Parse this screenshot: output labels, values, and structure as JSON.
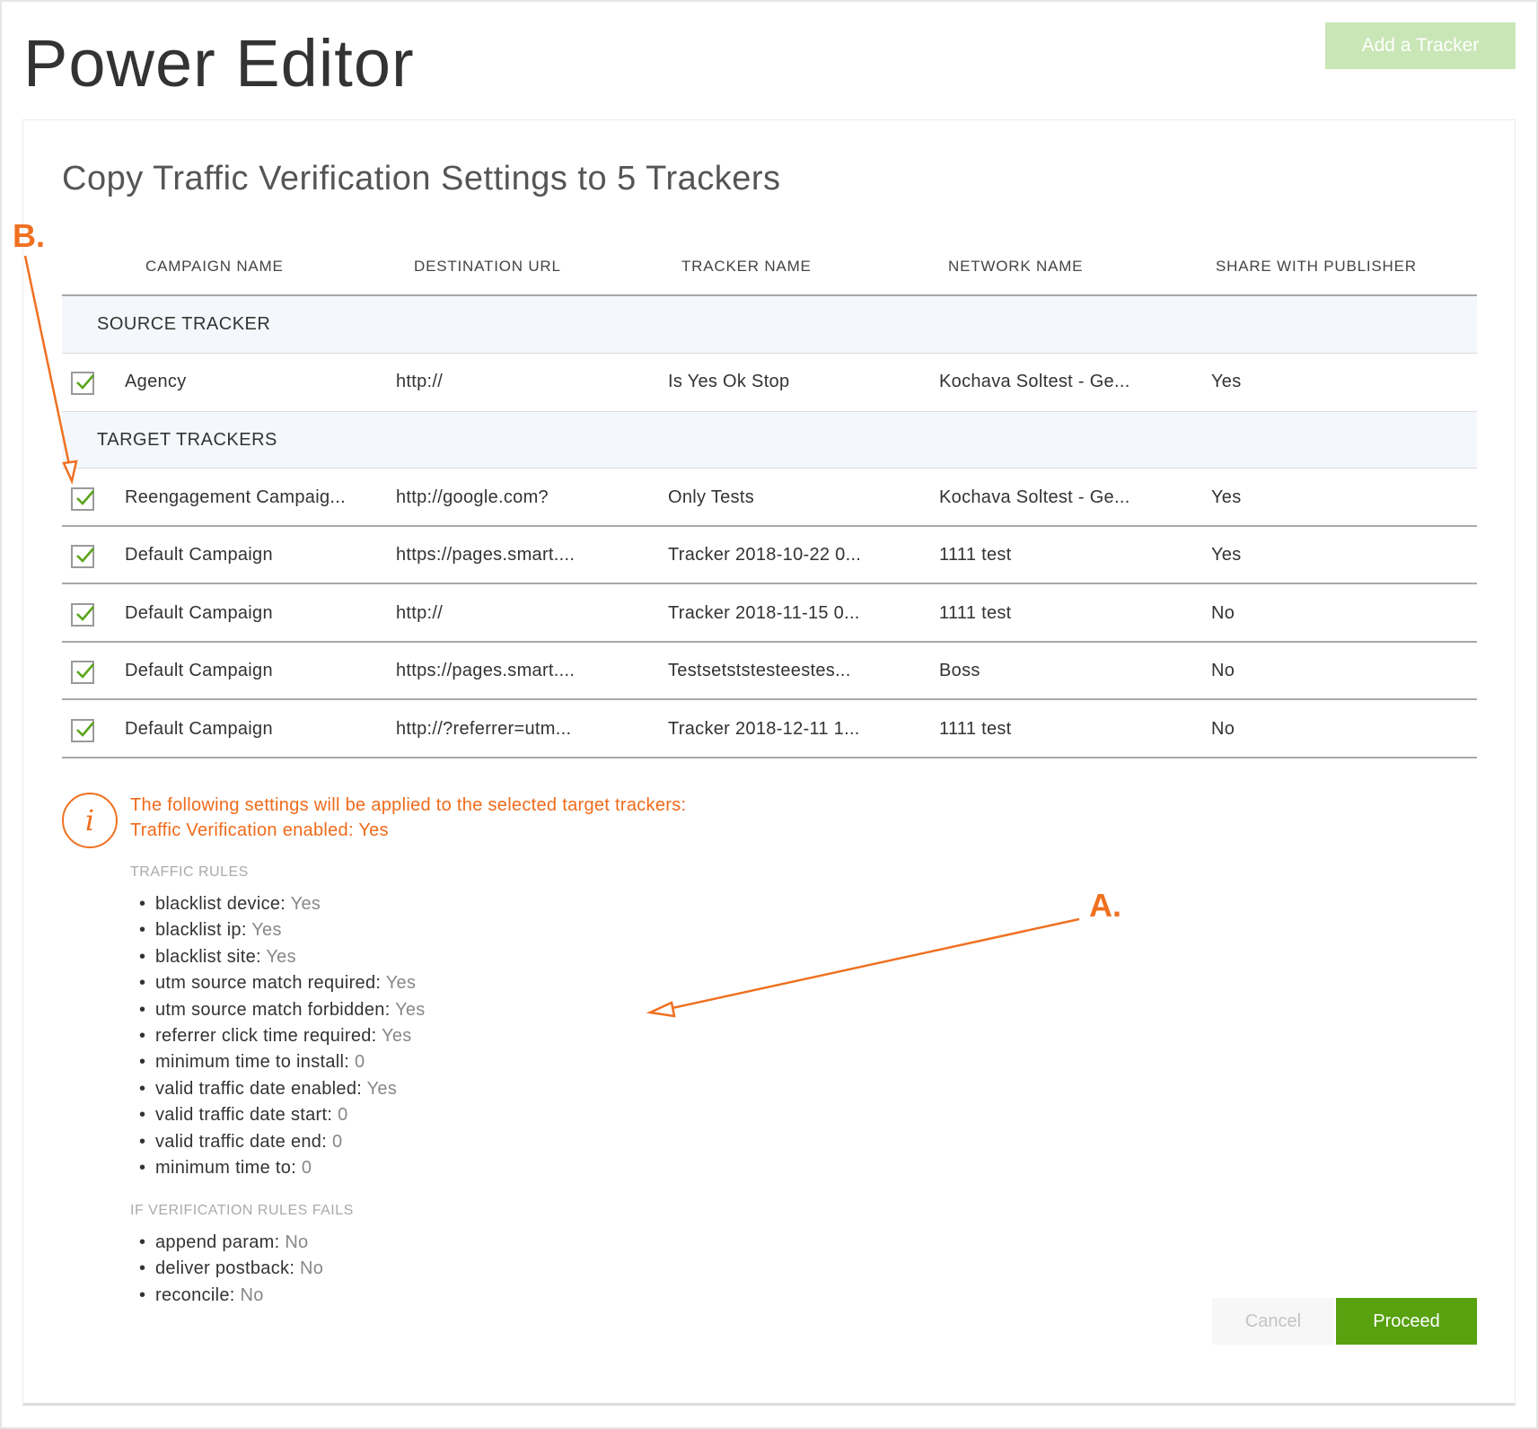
{
  "header": {
    "title": "Power Editor",
    "add_tracker_label": "Add a Tracker"
  },
  "dialog": {
    "title": "Copy Traffic Verification Settings to 5 Trackers",
    "columns": [
      "CAMPAIGN NAME",
      "DESTINATION URL",
      "TRACKER NAME",
      "NETWORK NAME",
      "SHARE WITH PUBLISHER"
    ],
    "source_section_label": "SOURCE TRACKER",
    "source_row": {
      "checked": true,
      "campaign": "Agency",
      "url": "http://",
      "tracker": "Is Yes Ok Stop",
      "network": "Kochava Soltest - Ge...",
      "share": "Yes"
    },
    "target_section_label": "TARGET TRACKERS",
    "target_rows": [
      {
        "checked": true,
        "campaign": "Reengagement Campaig...",
        "url": "http://google.com?",
        "tracker": "Only Tests",
        "network": "Kochava Soltest - Ge...",
        "share": "Yes"
      },
      {
        "checked": true,
        "campaign": "Default Campaign",
        "url": "https://pages.smart....",
        "tracker": "Tracker 2018-10-22 0...",
        "network": "1111 test",
        "share": "Yes"
      },
      {
        "checked": true,
        "campaign": "Default Campaign",
        "url": "http://",
        "tracker": "Tracker 2018-11-15 0...",
        "network": "1111 test",
        "share": "No"
      },
      {
        "checked": true,
        "campaign": "Default Campaign",
        "url": "https://pages.smart....",
        "tracker": "Testsetststesteestes...",
        "network": "Boss",
        "share": "No"
      },
      {
        "checked": true,
        "campaign": "Default Campaign",
        "url": "http://?referrer=utm...",
        "tracker": "Tracker 2018-12-11 1...",
        "network": "1111 test",
        "share": "No"
      }
    ]
  },
  "notice": {
    "icon": "info-icon",
    "line1": "The following settings will be applied to the selected target trackers:",
    "line2": "Traffic Verification enabled: Yes"
  },
  "traffic_rules": {
    "heading": "TRAFFIC RULES",
    "items": [
      {
        "label": "blacklist device:",
        "value": "Yes"
      },
      {
        "label": "blacklist ip:",
        "value": "Yes"
      },
      {
        "label": "blacklist site:",
        "value": "Yes"
      },
      {
        "label": "utm source match required:",
        "value": "Yes"
      },
      {
        "label": "utm source match forbidden:",
        "value": "Yes"
      },
      {
        "label": "referrer click time required:",
        "value": "Yes"
      },
      {
        "label": "minimum time to install:",
        "value": "0"
      },
      {
        "label": "valid traffic date enabled:",
        "value": "Yes"
      },
      {
        "label": "valid traffic date start:",
        "value": "0"
      },
      {
        "label": "valid traffic date end:",
        "value": "0"
      },
      {
        "label": "minimum time to:",
        "value": "0"
      }
    ]
  },
  "fail_rules": {
    "heading": "IF VERIFICATION RULES FAILS",
    "items": [
      {
        "label": "append param:",
        "value": "No"
      },
      {
        "label": "deliver postback:",
        "value": "No"
      },
      {
        "label": "reconcile:",
        "value": "No"
      }
    ]
  },
  "footer": {
    "cancel_label": "Cancel",
    "proceed_label": "Proceed"
  },
  "annotations": {
    "callout_a": "A.",
    "callout_b": "B."
  },
  "colors": {
    "accent_orange": "#f07020",
    "proceed_green": "#58a10f",
    "add_tracker_disabled": "#c9e6b6",
    "check_green": "#5aa51a"
  }
}
